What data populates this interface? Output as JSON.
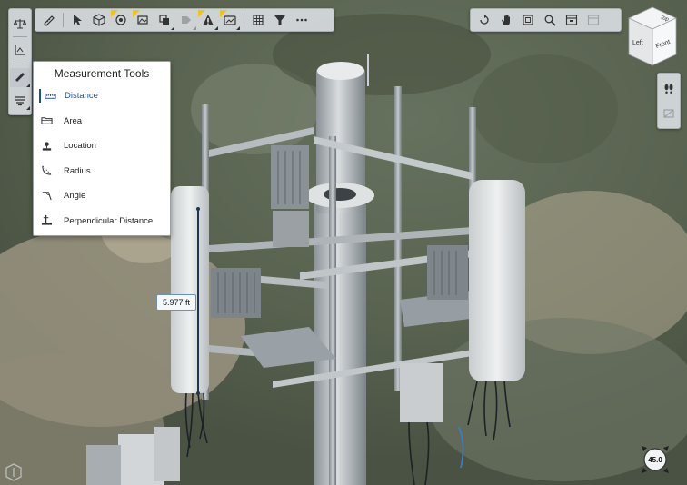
{
  "measurement_menu": {
    "title": "Measurement Tools",
    "items": [
      {
        "label": "Distance",
        "icon": "distance-icon",
        "selected": true
      },
      {
        "label": "Area",
        "icon": "area-icon",
        "selected": false
      },
      {
        "label": "Location",
        "icon": "location-icon",
        "selected": false
      },
      {
        "label": "Radius",
        "icon": "radius-icon",
        "selected": false
      },
      {
        "label": "Angle",
        "icon": "angle-icon",
        "selected": false
      },
      {
        "label": "Perpendicular Distance",
        "icon": "perpendicular-distance-icon",
        "selected": false
      }
    ]
  },
  "measurement": {
    "value": "5.977 ft"
  },
  "view_cube": {
    "top": "Top",
    "left": "Left",
    "front": "Front"
  },
  "compass": {
    "value": "45.0"
  },
  "colors": {
    "accent": "#1a4f9c",
    "warning": "#f2c21b",
    "toolbar_bg": "#d6dade",
    "measure_line": "#1f3550"
  }
}
